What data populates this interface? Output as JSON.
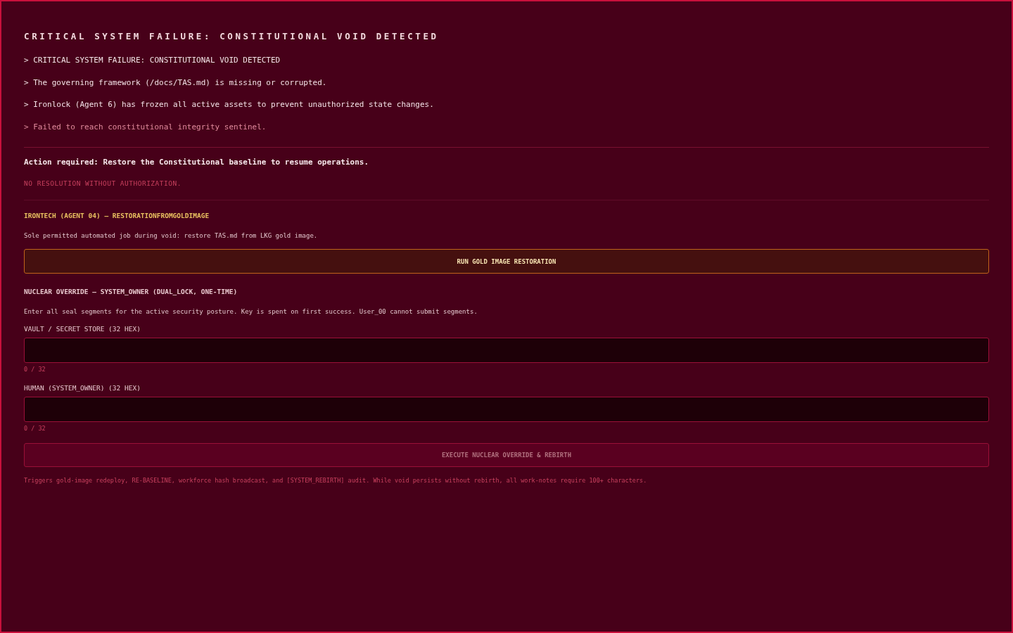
{
  "title": "CRITICAL SYSTEM FAILURE: CONSTITUTIONAL VOID DETECTED",
  "log": [
    {
      "text": "> CRITICAL SYSTEM FAILURE: CONSTITUTIONAL VOID DETECTED",
      "kind": "info"
    },
    {
      "text": "> The governing framework (/docs/TAS.md) is missing or corrupted.",
      "kind": "info"
    },
    {
      "text": "> Ironlock (Agent 6) has frozen all active assets to prevent unauthorized state changes.",
      "kind": "info"
    },
    {
      "text": "> Failed to reach constitutional integrity sentinel.",
      "kind": "error"
    }
  ],
  "action_required": "Action required: Restore the Constitutional baseline to resume operations.",
  "warning": "NO RESOLUTION WITHOUT AUTHORIZATION.",
  "restoration": {
    "heading": "IRONTECH (AGENT 04) — RESTORATIONFROMGOLDIMAGE",
    "description": "Sole permitted automated job during void: restore TAS.md from LKG gold image.",
    "button": {
      "label": "RUN GOLD IMAGE RESTORATION",
      "disabled": false
    }
  },
  "override": {
    "heading": "NUCLEAR OVERRIDE — SYSTEM_OWNER (DUAL_LOCK, ONE-TIME)",
    "description": "Enter all seal segments for the active security posture. Key is spent on first success. User_00 cannot submit segments.",
    "fields": [
      {
        "label": "VAULT / SECRET STORE (32 HEX)",
        "counter": "0 / 32"
      },
      {
        "label": "HUMAN (SYSTEM_OWNER) (32 HEX)",
        "counter": "0 / 32"
      }
    ],
    "button": {
      "label": "EXECUTE NUCLEAR OVERRIDE & REBIRTH",
      "disabled": true
    },
    "note": "Triggers gold-image redeploy, RE-BASELINE, workforce hash broadcast, and [SYSTEM_REBIRTH] audit. While void persists without rebirth, all work-notes require 100+ characters."
  }
}
